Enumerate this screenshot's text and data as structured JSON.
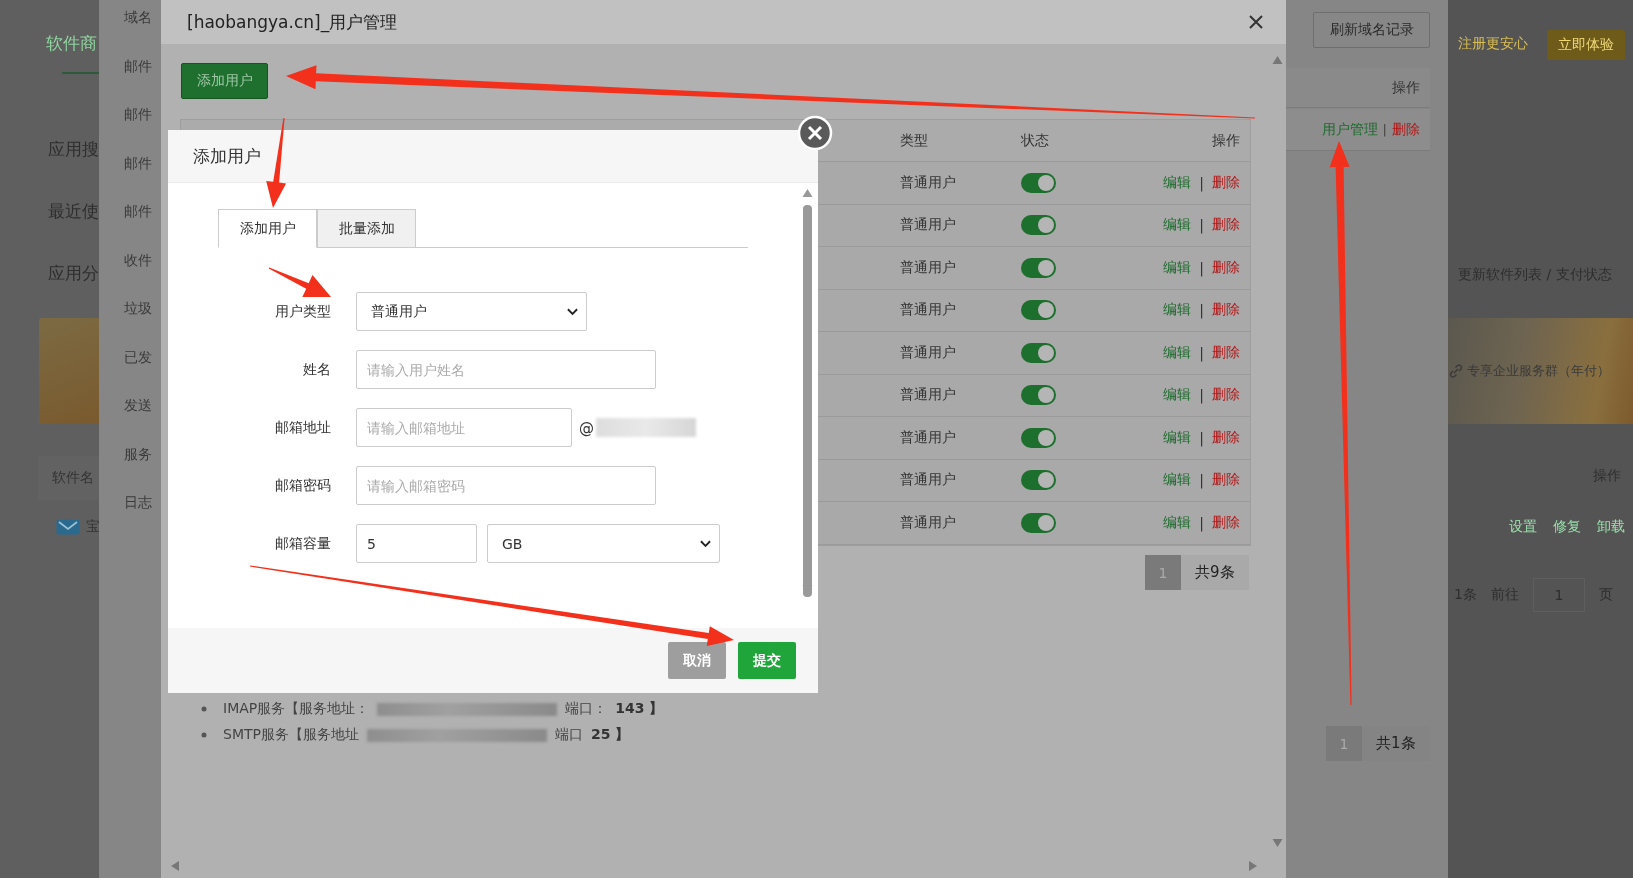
{
  "background_page": {
    "nav_title": "软件商",
    "menu": [
      "应用搜",
      "最近使",
      "应用分"
    ],
    "table_header": "软件名",
    "row_partial": "宝",
    "notice": "注册更安心",
    "try_button": "立即体验",
    "update_link": "更新软件列表 / 支付状态",
    "banner_text": "专享企业服务群（年付）",
    "actions_header": "操作",
    "actions": [
      "设置",
      "修复",
      "卸载"
    ],
    "pagination": {
      "total": "1条",
      "goto": "前往",
      "page": "1",
      "unit": "页"
    }
  },
  "domain_dialog": {
    "sidebar": [
      "域名",
      "邮件",
      "邮件",
      "邮件",
      "邮件",
      "收件",
      "垃圾",
      "已发",
      "发送",
      "服务",
      "日志"
    ],
    "refresh_button": "刷新域名记录",
    "table_header": "操作",
    "row": {
      "manage_link": "用户管理",
      "separator": "|",
      "delete_link": "删除"
    },
    "pagination": {
      "page": "1",
      "total": "共1条"
    }
  },
  "user_dialog": {
    "title": "[haobangya.cn]_用户管理",
    "add_button": "添加用户",
    "columns": [
      "类型",
      "状态",
      "操作"
    ],
    "rows": [
      {
        "type": "普通用户",
        "enabled": true,
        "edit": "编辑",
        "separator": "|",
        "delete": "删除"
      },
      {
        "type": "普通用户",
        "enabled": true,
        "edit": "编辑",
        "separator": "|",
        "delete": "删除"
      },
      {
        "type": "普通用户",
        "enabled": true,
        "edit": "编辑",
        "separator": "|",
        "delete": "删除"
      },
      {
        "type": "普通用户",
        "enabled": true,
        "edit": "编辑",
        "separator": "|",
        "delete": "删除"
      },
      {
        "type": "普通用户",
        "enabled": true,
        "edit": "编辑",
        "separator": "|",
        "delete": "删除"
      },
      {
        "type": "普通用户",
        "enabled": true,
        "edit": "编辑",
        "separator": "|",
        "delete": "删除"
      },
      {
        "type": "普通用户",
        "enabled": true,
        "edit": "编辑",
        "separator": "|",
        "delete": "删除"
      },
      {
        "type": "普通用户",
        "enabled": true,
        "edit": "编辑",
        "separator": "|",
        "delete": "删除"
      },
      {
        "type": "普通用户",
        "enabled": true,
        "edit": "编辑",
        "separator": "|",
        "delete": "删除"
      }
    ],
    "pagination": {
      "page": "1",
      "total": "共9条"
    },
    "services": [
      {
        "label": "IMAP服务【服务地址：",
        "port_label": "端口：",
        "port": "143 】"
      },
      {
        "label": "SMTP服务【服务地址",
        "port_label": "端口",
        "port": "25 】"
      }
    ]
  },
  "add_user_modal": {
    "title": "添加用户",
    "tabs": [
      {
        "label": "添加用户",
        "selected": true
      },
      {
        "label": "批量添加",
        "selected": false
      }
    ],
    "fields": [
      {
        "kind": "select",
        "label": "用户类型",
        "value": "普通用户"
      },
      {
        "kind": "text",
        "label": "姓名",
        "placeholder": "请输入用户姓名"
      },
      {
        "kind": "email",
        "label": "邮箱地址",
        "placeholder": "请输入邮箱地址",
        "suffix": "@"
      },
      {
        "kind": "text",
        "label": "邮箱密码",
        "placeholder": "请输入邮箱密码"
      },
      {
        "kind": "quota",
        "label": "邮箱容量",
        "value": "5",
        "unit": "GB"
      }
    ],
    "buttons": [
      {
        "kind": "cancel",
        "label": "取消"
      },
      {
        "kind": "submit",
        "label": "提交"
      }
    ]
  }
}
